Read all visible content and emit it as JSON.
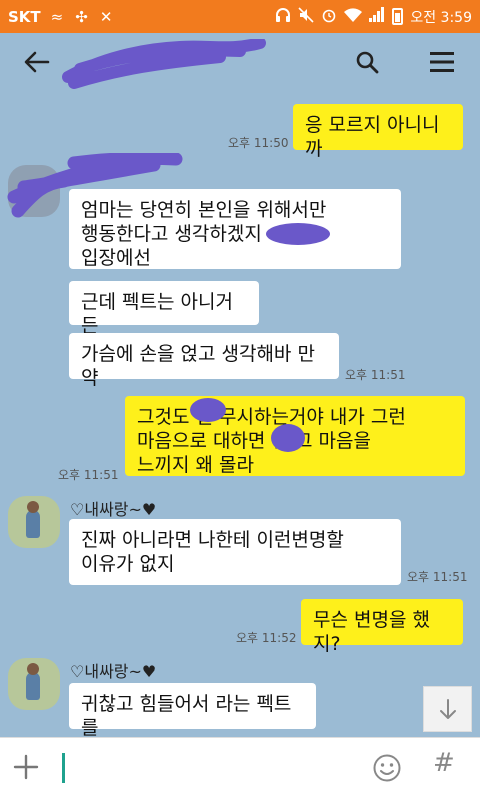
{
  "status_bar": {
    "carrier": "SKT",
    "clock": "오전 3:59"
  },
  "chat": {
    "messages": [
      {
        "text": "응 모르지 아니니까",
        "time": "오후 11:50"
      },
      {
        "text": "엄마는 당연히 본인을 위해서만\n행동한다고 생각하겠지\n입장에선"
      },
      {
        "text": "근데 펙트는 아니거든"
      },
      {
        "text": "가슴에 손을 얹고 생각해바 만약",
        "time": "오후 11:51"
      },
      {
        "text": "그것도    일 무시하는거야 내가 그런\n마음으로 대하면    인 그 마음을\n느끼지 왜 몰라",
        "time": "오후 11:51"
      },
      {
        "text": "진짜 아니라면 나한테 이런변명할\n이유가 없지",
        "time": "오후 11:51"
      },
      {
        "text": "무슨 변명을 했지?",
        "time": "오후 11:52"
      },
      {
        "text": "귀찮고 힘들어서 라는 펙트를"
      }
    ],
    "sender_name": "♡내싸랑~♥"
  },
  "input": {
    "placeholder": ""
  },
  "colors": {
    "background": "#9bbbd4",
    "status_bar": "#f27b1e",
    "my_bubble": "#fef01b",
    "their_bubble": "#ffffff",
    "cursor": "#1fa28e",
    "redaction": "#6a58c9"
  }
}
